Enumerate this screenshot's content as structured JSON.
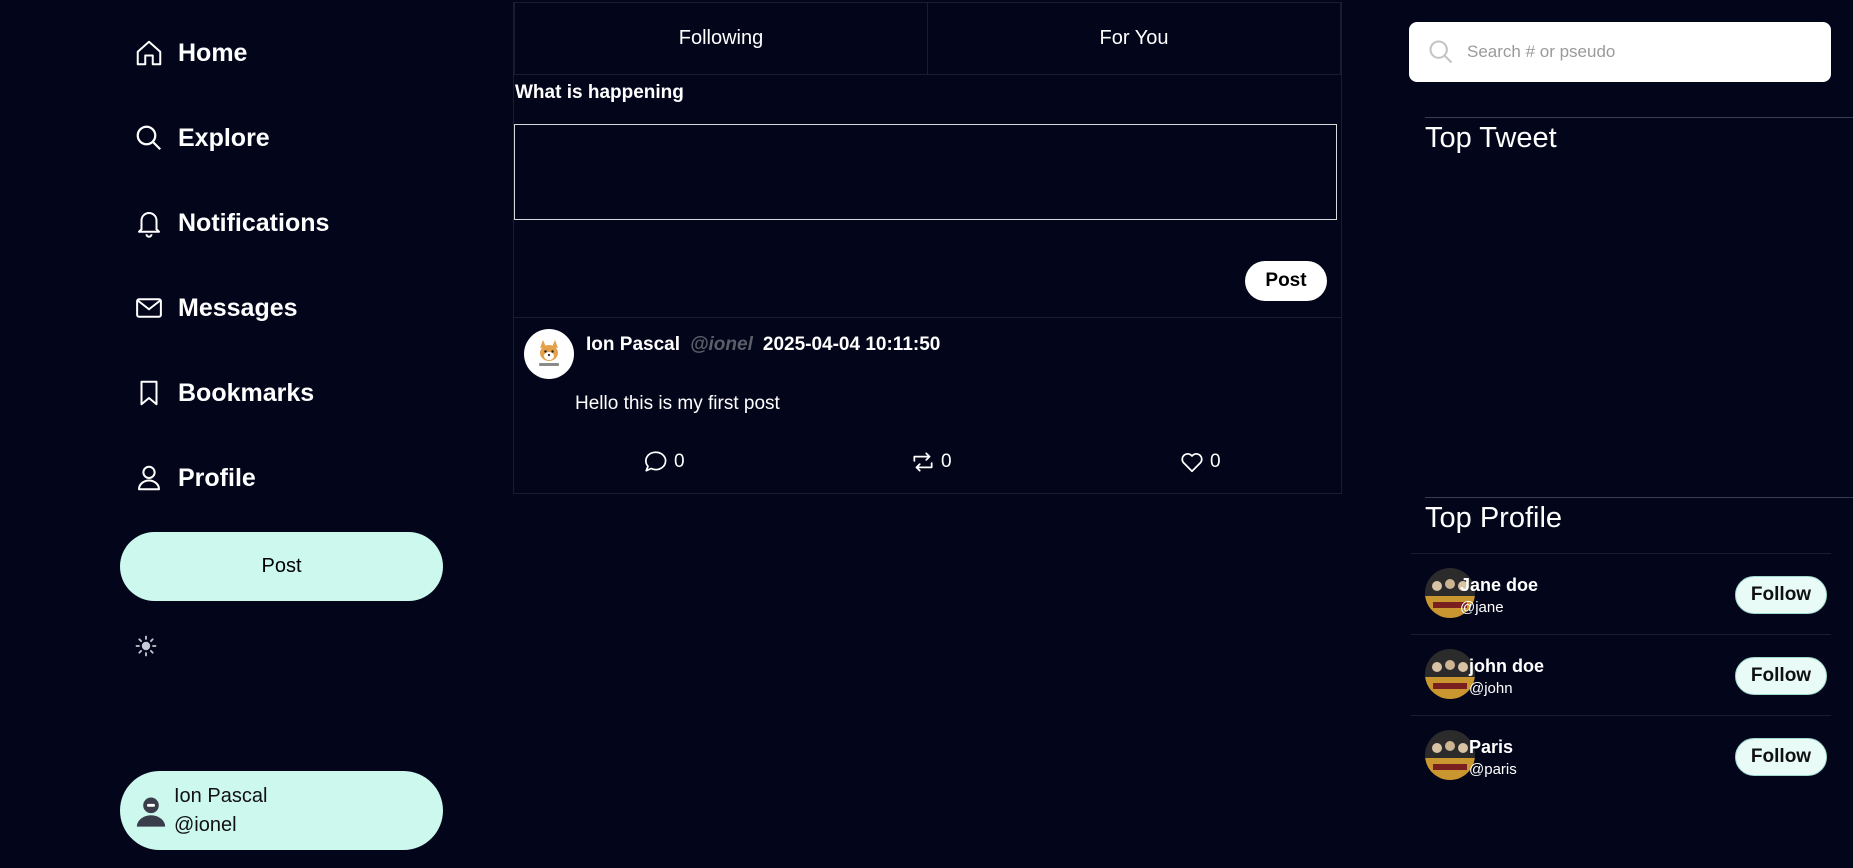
{
  "sidebar": {
    "nav": [
      {
        "label": "Home",
        "icon": "home-icon"
      },
      {
        "label": "Explore",
        "icon": "search-icon"
      },
      {
        "label": "Notifications",
        "icon": "bell-icon"
      },
      {
        "label": "Messages",
        "icon": "mail-icon"
      },
      {
        "label": "Bookmarks",
        "icon": "bookmark-icon"
      },
      {
        "label": "Profile",
        "icon": "user-icon"
      }
    ],
    "post_label": "Post",
    "theme_icon": "sun-icon",
    "user": {
      "name": "Ion Pascal",
      "handle": "@ionel"
    }
  },
  "main": {
    "tabs": [
      {
        "label": "Following"
      },
      {
        "label": "For You"
      }
    ],
    "compose": {
      "title": "What is happening",
      "post_label": "Post"
    },
    "tweets": [
      {
        "author": "Ion Pascal",
        "handle": "@ionel",
        "timestamp": "2025-04-04 10:11:50",
        "text": "Hello this is my first post",
        "comments": "0",
        "retweets": "0",
        "likes": "0"
      }
    ]
  },
  "right": {
    "search_placeholder": "Search # or pseudo",
    "top_tweet_title": "Top Tweet",
    "top_profile_title": "Top Profile",
    "profiles": [
      {
        "name": "Jane doe",
        "handle": "@jane",
        "follow_label": "Follow"
      },
      {
        "name": "john doe",
        "handle": "@john",
        "follow_label": "Follow"
      },
      {
        "name": "Paris",
        "handle": "@paris",
        "follow_label": "Follow"
      }
    ]
  },
  "colors": {
    "background": "#03051a",
    "accent": "#ccf8ee",
    "handle_gray": "#5b5d68"
  }
}
